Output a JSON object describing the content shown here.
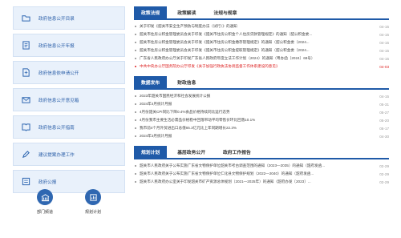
{
  "sidebar": {
    "items": [
      {
        "label": "政府信息公开目录",
        "icon": "folder-icon"
      },
      {
        "label": "政府信息公开年报",
        "icon": "report-icon"
      },
      {
        "label": "政府信息依申请公开",
        "icon": "document-request-icon"
      },
      {
        "label": "政府信息公开意见箱",
        "icon": "mailbox-icon"
      },
      {
        "label": "政府信息公开指南",
        "icon": "guide-icon"
      },
      {
        "label": "建议提案办理工作",
        "icon": "edit-icon"
      },
      {
        "label": "政府公报",
        "icon": "bulletin-icon"
      }
    ]
  },
  "quick": [
    {
      "label": "部门频道",
      "icon": "building-icon"
    },
    {
      "label": "规划计划",
      "icon": "plan-icon"
    }
  ],
  "panels": [
    {
      "tabs": [
        "政策法规",
        "政策解读",
        "法规与规章"
      ],
      "rows": [
        {
          "title": "关于印发《韶关市安全生产预防与制度办法（试行）》的通知",
          "date": "04-15"
        },
        {
          "title": "韶关市住房公积金管理委员会关于印发《韶关市住房公积金个人住房贷款管理规定》的通知（韶公积金委...",
          "date": "04-15"
        },
        {
          "title": "韶关市住房公积金管理委员会关于印发《韶关市住房公积金缴存管理规定》的通知（韶公积金委〔2024...",
          "date": "04-15"
        },
        {
          "title": "韶关市住房公积金管理委员会关于印发《韶关市住房公积金提取管理规定》的通知（韶公积金委〔2024...",
          "date": "04-15"
        },
        {
          "title": "广东省人民政府办公厅关于印发广东省人民政府年度立法工作计划（2024）的通知（粤办函〔2024〕68号）",
          "date": "04-15"
        },
        {
          "title": "中共中央办公厅国务院办公厅印发《关于加强行政执法协调监督工作体系建设的意见》",
          "date": "04-03",
          "red": true
        }
      ]
    },
    {
      "tabs": [
        "数据发布",
        "财政信息"
      ],
      "rows": [
        {
          "title": "2023年韶关市国民经济和社会发展统计公报",
          "date": "04-15"
        },
        {
          "title": "2024年4月统计月报",
          "date": "05-31"
        },
        {
          "title": "4月份韶关CPI同比下降0.4%食品价格持续同比运行态势",
          "date": "05-27"
        },
        {
          "title": "4月份我市主要生活必需品价格稳中回落带动平均零售价环比回落10.1%",
          "date": "05-20"
        },
        {
          "title": "我市前4个月外贸进出口总值65.3亿元比上年同期增长22.3%",
          "date": "05-17"
        },
        {
          "title": "2024年3月统计月报",
          "date": "04-30"
        }
      ]
    },
    {
      "tabs": [
        "规划计划",
        "基层政务公开",
        "政府工作报告"
      ],
      "rows": [
        {
          "title": "韶关市人民政府关于公布实施广东省文物保护单位韶关市考古调查范围的通知（2023—2035）的通知（韶府发函...",
          "date": "02-29"
        },
        {
          "title": "韶关市人民政府关于公布实施广东省文物保护单位仁化县文物保护规划（2022—2040）的通知（韶府发函...",
          "date": "02-29"
        },
        {
          "title": "韶关市人民政府办公室关于印发韶关市矿产资源总体规划（2021—2025年）的通知（韶府办发〔2023〕...",
          "date": "02-29"
        }
      ]
    }
  ],
  "colors": {
    "accent": "#1f5aa8",
    "sidebar_bg": "#e9f1fb",
    "highlight_text": "#dd2222"
  }
}
